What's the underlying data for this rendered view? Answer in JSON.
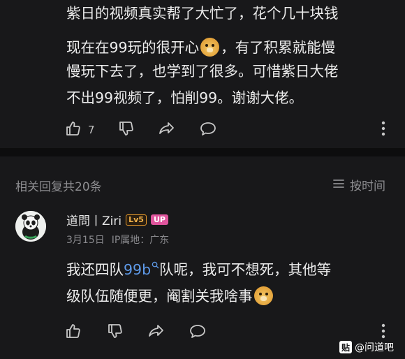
{
  "comment_top": {
    "lines": [
      "紫日的视频真实帮了大忙了，花个几十块钱",
      "现在在99玩的很开心",
      "，有了积累就能慢",
      "慢玩下去了，也学到了很多。可惜紫日大佬",
      "不出99视频了，怕削99。谢谢大佬。"
    ],
    "like_count": "7"
  },
  "replies_header": {
    "title": "相关回复共20条",
    "sort_label": "按时间"
  },
  "reply": {
    "username": "道問丨Ziri",
    "level_badge": "Lv5",
    "up_badge": "UP",
    "date": "3月15日",
    "location": "IP属地：广东",
    "line1_a": "我还四队",
    "line1_link": "99b",
    "line1_b": "队呢，我可不想死，其他等",
    "line2": "级队伍随便更，阉割关我啥事"
  },
  "watermark": {
    "text": "@问道吧"
  }
}
